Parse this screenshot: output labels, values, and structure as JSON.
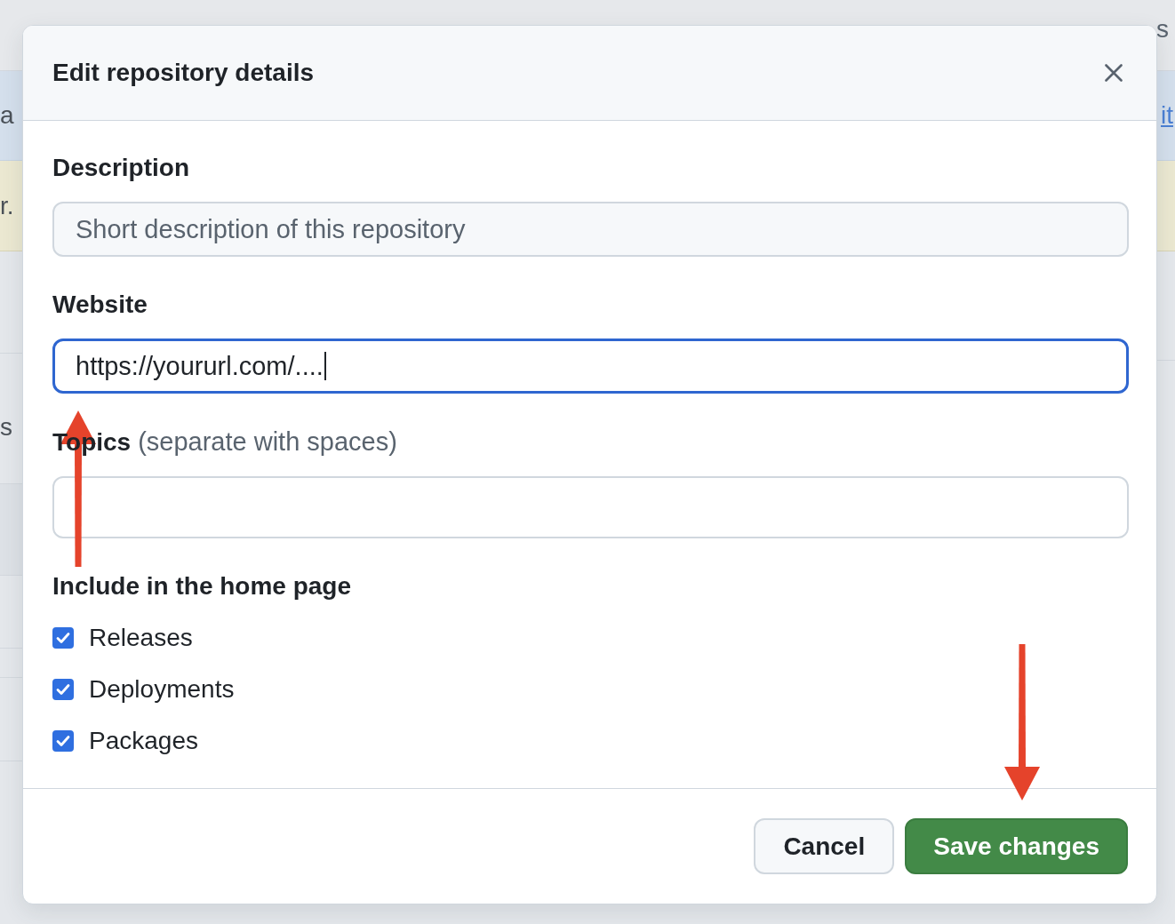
{
  "background": {
    "nav_tail": "s",
    "banner_left": "a",
    "banner_link": "it",
    "notice_left": "r.",
    "sidebar_left": "s"
  },
  "dialog": {
    "title": "Edit repository details",
    "fields": [
      {
        "label": "Description",
        "kind": "text",
        "placeholder": "Short description of this repository",
        "focused": false
      },
      {
        "label": "Website",
        "kind": "text",
        "value": "https://yoururl.com/....",
        "focused": true
      },
      {
        "label": "Topics",
        "hint": "(separate with spaces)",
        "kind": "tags",
        "focused": false
      }
    ],
    "home_page": {
      "heading": "Include in the home page",
      "options": [
        {
          "label": "Releases",
          "checked": true
        },
        {
          "label": "Deployments",
          "checked": true
        },
        {
          "label": "Packages",
          "checked": true
        }
      ]
    },
    "buttons": [
      {
        "label": "Cancel",
        "kind": "secondary"
      },
      {
        "label": "Save changes",
        "kind": "primary"
      }
    ]
  },
  "annotations": [
    {
      "kind": "arrow_up"
    },
    {
      "kind": "arrow_down"
    }
  ]
}
